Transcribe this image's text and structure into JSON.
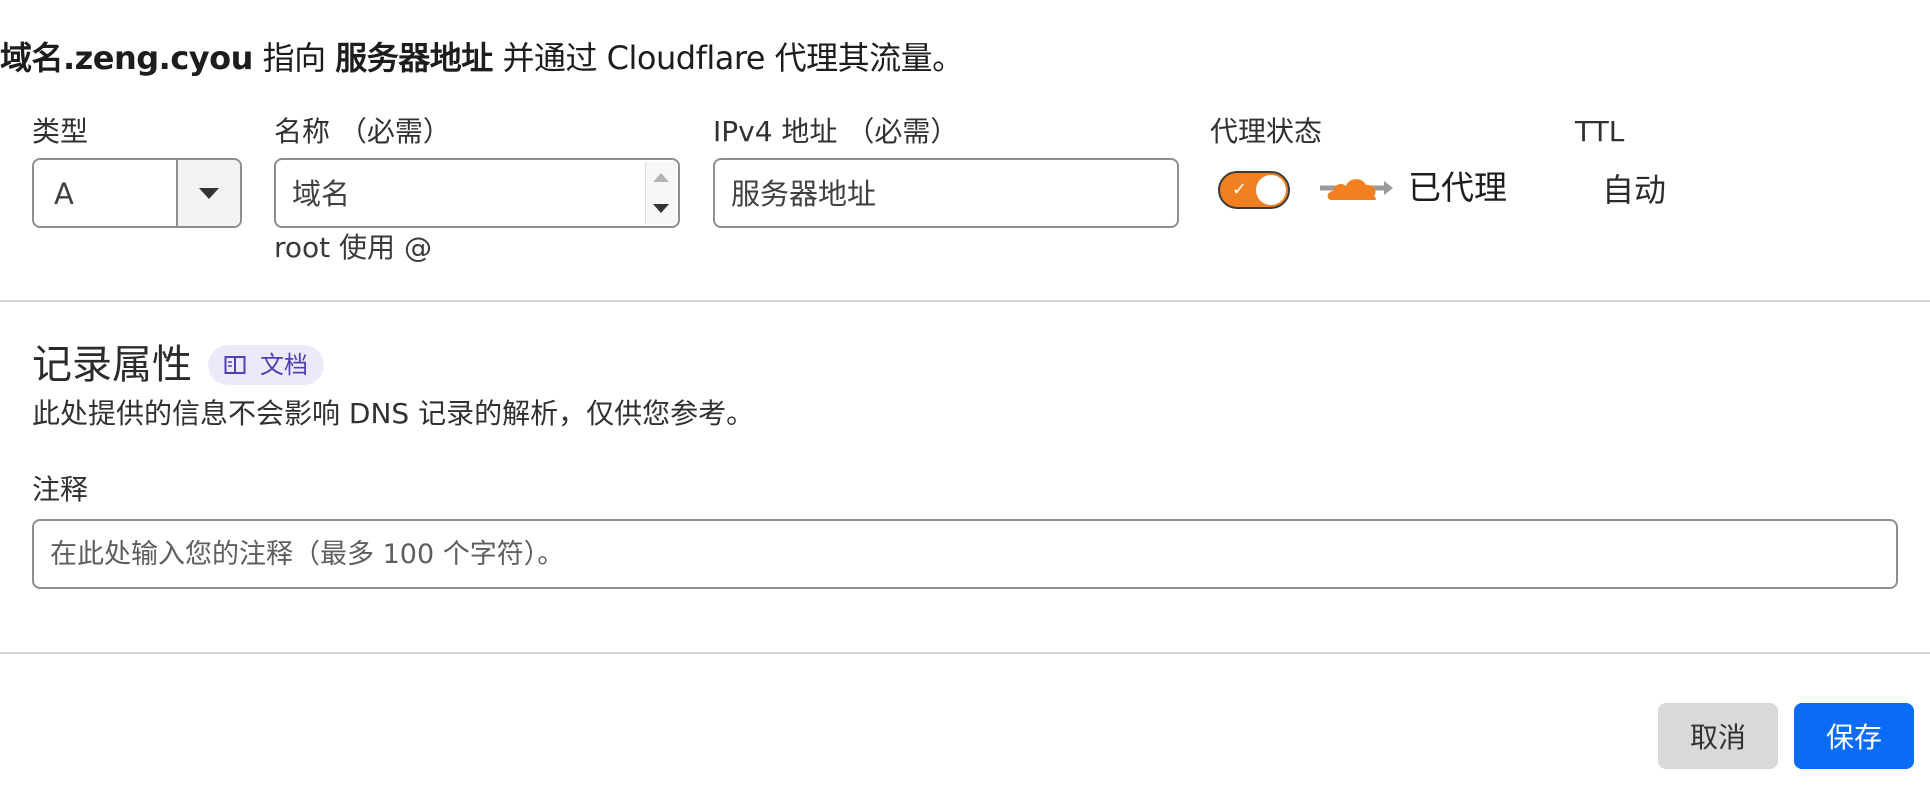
{
  "summary": {
    "name": "域名.zeng.cyou",
    "points_to": "指向",
    "target": "服务器地址",
    "rest": "并通过 Cloudflare 代理其流量。"
  },
  "form": {
    "type_label": "类型",
    "type_value": "A",
    "name_label": "名称 （必需）",
    "name_value": "域名",
    "name_hint": "root 使用 @",
    "ipv4_label": "IPv4 地址 （必需）",
    "ipv4_value": "服务器地址",
    "proxy_label": "代理状态",
    "proxy_status": "已代理",
    "proxy_enabled": true,
    "ttl_label": "TTL",
    "ttl_value": "自动"
  },
  "record_attributes": {
    "title": "记录属性",
    "docs_label": "文档",
    "description": "此处提供的信息不会影响 DNS 记录的解析，仅供您参考。",
    "comment_label": "注释",
    "comment_placeholder": "在此处输入您的注释（最多 100 个字符）。"
  },
  "actions": {
    "cancel_label": "取消",
    "save_label": "保存"
  },
  "colors": {
    "accent": "#f38020",
    "primary": "#0a6cf5",
    "badge_text": "#5040b0"
  }
}
